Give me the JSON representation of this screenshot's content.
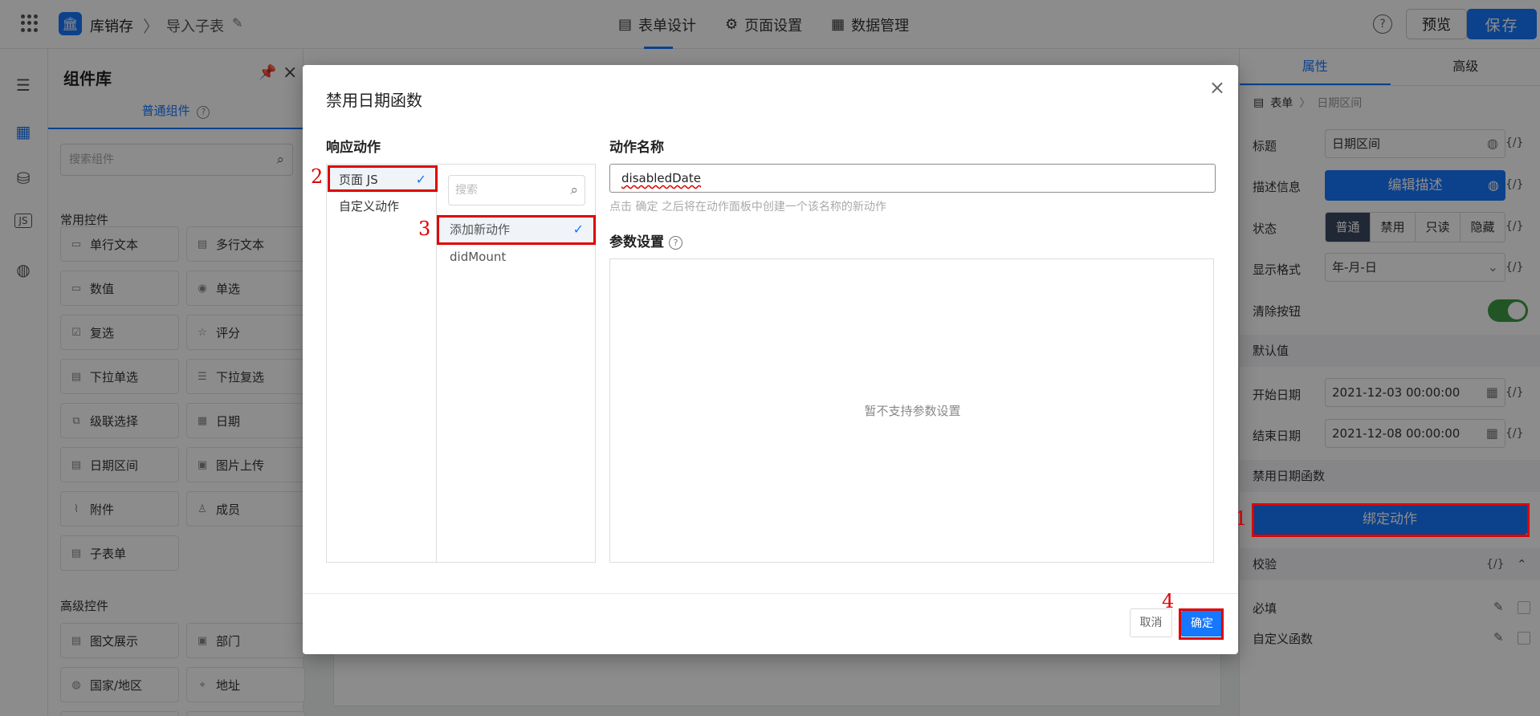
{
  "header": {
    "app_logo_glyph": "🏛",
    "app_name": "库销存",
    "crumb_sep": "〉",
    "page_name": "导入子表",
    "tabs": [
      {
        "label": "表单设计",
        "icon": "▤"
      },
      {
        "label": "页面设置",
        "icon": "⚙"
      },
      {
        "label": "数据管理",
        "icon": "▦"
      }
    ],
    "help": "?",
    "preview_label": "预览",
    "save_label": "保存"
  },
  "library": {
    "title": "组件库",
    "tab_label": "普通组件",
    "search_placeholder": "搜索组件",
    "section_common": "常用控件",
    "section_advanced": "高级控件",
    "common_items": [
      "单行文本",
      "多行文本",
      "数值",
      "单选",
      "复选",
      "评分",
      "下拉单选",
      "下拉复选",
      "级联选择",
      "日期",
      "日期区间",
      "图片上传",
      "附件",
      "成员",
      "子表单"
    ],
    "advanced_items": [
      "图文展示",
      "部门",
      "国家/地区",
      "地址"
    ]
  },
  "properties": {
    "tabs": [
      "属性",
      "高级"
    ],
    "crumb_root": "表单",
    "crumb_current": "日期区间",
    "title_label": "标题",
    "title_value": "日期区间",
    "desc_label": "描述信息",
    "desc_button": "编辑描述",
    "state_label": "状态",
    "state_options": [
      "普通",
      "禁用",
      "只读",
      "隐藏"
    ],
    "format_label": "显示格式",
    "format_value": "年-月-日",
    "clear_label": "清除按钮",
    "default_section": "默认值",
    "start_label": "开始日期",
    "start_value": "2021-12-03 00:00:00",
    "end_label": "结束日期",
    "end_value": "2021-12-08 00:00:00",
    "disable_section": "禁用日期函数",
    "bind_button": "绑定动作",
    "validate_section": "校验",
    "required_label": "必填",
    "custom_fn_label": "自定义函数",
    "fx": "{/}"
  },
  "modal": {
    "title": "禁用日期函数",
    "response_label": "响应动作",
    "col1_items": [
      "页面 JS",
      "自定义动作"
    ],
    "search_placeholder": "搜索",
    "col2_items": [
      "添加新动作",
      "didMount"
    ],
    "action_name_label": "动作名称",
    "action_name_value": "disabledDate",
    "hint": "点击 确定 之后将在动作面板中创建一个该名称的新动作",
    "params_label": "参数设置",
    "params_empty": "暂不支持参数设置",
    "cancel_label": "取消",
    "ok_label": "确定"
  },
  "annotations": [
    "1",
    "2",
    "3",
    "4"
  ]
}
